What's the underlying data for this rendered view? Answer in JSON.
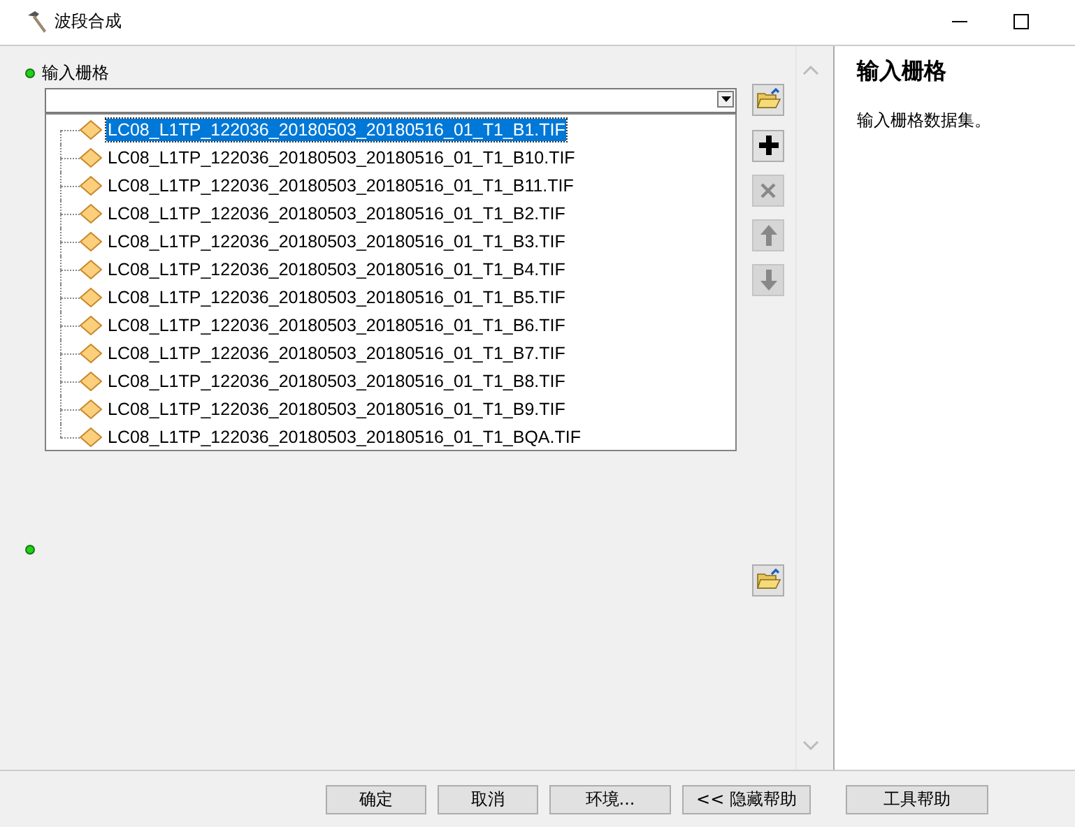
{
  "window": {
    "title": "波段合成"
  },
  "parameters": [
    {
      "label": "输入栅格",
      "required": true
    },
    {
      "required": true
    }
  ],
  "dropdown": {
    "items": [
      {
        "label": "LC08_L1TP_122036_20180503_20180516_01_T1_B1.TIF",
        "selected": true
      },
      {
        "label": "LC08_L1TP_122036_20180503_20180516_01_T1_B10.TIF",
        "selected": false
      },
      {
        "label": "LC08_L1TP_122036_20180503_20180516_01_T1_B11.TIF",
        "selected": false
      },
      {
        "label": "LC08_L1TP_122036_20180503_20180516_01_T1_B2.TIF",
        "selected": false
      },
      {
        "label": "LC08_L1TP_122036_20180503_20180516_01_T1_B3.TIF",
        "selected": false
      },
      {
        "label": "LC08_L1TP_122036_20180503_20180516_01_T1_B4.TIF",
        "selected": false
      },
      {
        "label": "LC08_L1TP_122036_20180503_20180516_01_T1_B5.TIF",
        "selected": false
      },
      {
        "label": "LC08_L1TP_122036_20180503_20180516_01_T1_B6.TIF",
        "selected": false
      },
      {
        "label": "LC08_L1TP_122036_20180503_20180516_01_T1_B7.TIF",
        "selected": false
      },
      {
        "label": "LC08_L1TP_122036_20180503_20180516_01_T1_B8.TIF",
        "selected": false
      },
      {
        "label": "LC08_L1TP_122036_20180503_20180516_01_T1_B9.TIF",
        "selected": false
      },
      {
        "label": "LC08_L1TP_122036_20180503_20180516_01_T1_BQA.TIF",
        "selected": false
      }
    ]
  },
  "list_tools": [
    {
      "kind": "add",
      "disabled": false
    },
    {
      "kind": "remove",
      "disabled": true
    },
    {
      "kind": "up",
      "disabled": true
    },
    {
      "kind": "down",
      "disabled": true
    }
  ],
  "help": {
    "title": "输入栅格",
    "text": "输入栅格数据集。"
  },
  "buttons": [
    "确定",
    "取消",
    "环境...",
    "<< 隐藏帮助",
    "工具帮助"
  ]
}
